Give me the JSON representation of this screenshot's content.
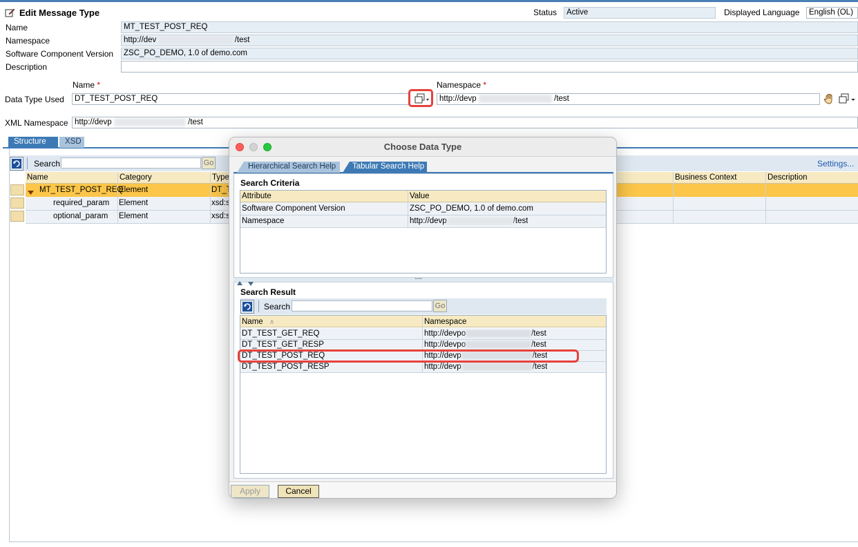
{
  "header": {
    "title": "Edit Message Type",
    "status_label": "Status",
    "status_value": "Active",
    "language_label": "Displayed Language",
    "language_value": "English (OL)"
  },
  "form": {
    "name_label": "Name",
    "name_value": "MT_TEST_POST_REQ",
    "namespace_label": "Namespace",
    "namespace_prefix": "http://dev",
    "namespace_suffix": "/test",
    "swcv_label": "Software Component Version",
    "swcv_value": "ZSC_PO_DEMO, 1.0 of demo.com",
    "description_label": "Description",
    "description_value": "",
    "dt_name_header": "Name",
    "dt_namespace_header": "Namespace",
    "required_mark": "*",
    "dt_used_label": "Data Type Used",
    "dt_used_value": "DT_TEST_POST_REQ",
    "dt_namespace_prefix": "http://devp",
    "dt_namespace_suffix": "/test",
    "xml_ns_label": "XML Namespace",
    "xml_ns_prefix": "http://devp",
    "xml_ns_suffix": "/test"
  },
  "tabs": [
    {
      "label": "Structure",
      "active": true
    },
    {
      "label": "XSD",
      "active": false
    }
  ],
  "structure": {
    "search_label": "Search",
    "go_label": "Go",
    "settings_label": "Settings...",
    "columns": [
      "Name",
      "Category",
      "Type",
      "Business Context",
      "Description"
    ],
    "rows": [
      {
        "name": "MT_TEST_POST_REQ",
        "category": "Element",
        "type": "DT_T"
      },
      {
        "name": "required_param",
        "category": "Element",
        "type": "xsd:s"
      },
      {
        "name": "optional_param",
        "category": "Element",
        "type": "xsd:s"
      }
    ]
  },
  "dialog": {
    "title": "Choose Data Type",
    "tabs": [
      "Hierarchical Search Help",
      "Tabular Search Help"
    ],
    "criteria_title": "Search Criteria",
    "criteria_columns": [
      "Attribute",
      "Value"
    ],
    "criteria_rows": [
      {
        "attribute": "Software Component Version",
        "value": "ZSC_PO_DEMO, 1.0 of demo.com"
      },
      {
        "attribute": "Namespace",
        "value_prefix": "http://devp",
        "value_suffix": "/test"
      }
    ],
    "splitter": "......",
    "result_title": "Search Result",
    "search_label": "Search",
    "go_label": "Go",
    "result_columns": [
      "Name",
      "Namespace"
    ],
    "sort_indicator": "∧",
    "result_rows": [
      {
        "name": "DT_TEST_GET_REQ",
        "ns_prefix": "http://devpo",
        "ns_suffix": "/test"
      },
      {
        "name": "DT_TEST_GET_RESP",
        "ns_prefix": "http://devpo",
        "ns_suffix": "/test"
      },
      {
        "name": "DT_TEST_POST_REQ",
        "ns_prefix": "http://devp",
        "ns_suffix": "/test"
      },
      {
        "name": "DT_TEST_POST_RESP",
        "ns_prefix": "http://devp",
        "ns_suffix": "/test"
      }
    ],
    "apply_label": "Apply",
    "cancel_label": "Cancel"
  },
  "colors": {
    "highlight_red": "#e8403a",
    "tab_active": "#3d7ab5",
    "row_selected": "#fcc64a",
    "grid_header": "#f7eac2"
  }
}
